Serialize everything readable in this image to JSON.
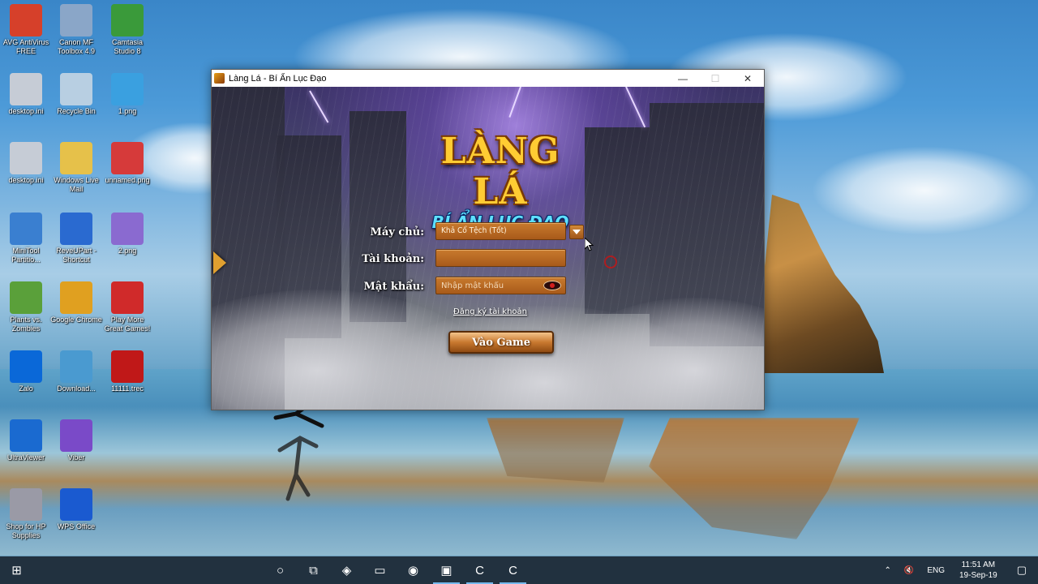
{
  "desktop": {
    "icons": [
      {
        "label": "AVG AntiVirus FREE",
        "icon": "avg-antivirus-icon",
        "color": "#d6402a"
      },
      {
        "label": "Canon MF Toolbox 4.9",
        "icon": "canon-toolbox-icon",
        "color": "#8aa6c8"
      },
      {
        "label": "Camtasia Studio 8",
        "icon": "camtasia-icon",
        "color": "#3a9a3a"
      },
      {
        "label": "desktop.ini",
        "icon": "ini-file-icon",
        "color": "#c6ccd6"
      },
      {
        "label": "Recycle Bin",
        "icon": "recycle-bin-icon",
        "color": "#b8cfe2"
      },
      {
        "label": "1.png",
        "icon": "image-file-icon",
        "color": "#3aa0e0"
      },
      {
        "label": "desktop.ini",
        "icon": "ini-file-icon",
        "color": "#c6ccd6"
      },
      {
        "label": "Windows Live Mail",
        "icon": "windows-live-mail-icon",
        "color": "#e6c14a"
      },
      {
        "label": "unnamed.png",
        "icon": "image-file-icon",
        "color": "#d63a3a"
      },
      {
        "label": "MiniTool Partitio...",
        "icon": "minitool-icon",
        "color": "#3a7fd0"
      },
      {
        "label": "ReveUPart - Shortcut",
        "icon": "shortcut-icon",
        "color": "#2a6ad0"
      },
      {
        "label": "2.png",
        "icon": "image-file-icon",
        "color": "#8a6ad0"
      },
      {
        "label": "Plants vs. Zombies",
        "icon": "plants-vs-zombies-icon",
        "color": "#5aa03a"
      },
      {
        "label": "Google Chrome",
        "icon": "chrome-icon",
        "color": "#e0a020"
      },
      {
        "label": "Play More Great Games!",
        "icon": "popcap-icon",
        "color": "#d02a2a"
      },
      {
        "label": "Zalo",
        "icon": "zalo-icon",
        "color": "#0a68d8"
      },
      {
        "label": "Download...",
        "icon": "download-folder-icon",
        "color": "#4a9ad0"
      },
      {
        "label": "11111.trec",
        "icon": "trec-file-icon",
        "color": "#c01818"
      },
      {
        "label": "UltraViewer",
        "icon": "ultraviewer-icon",
        "color": "#1a6ad0"
      },
      {
        "label": "Viber",
        "icon": "viber-icon",
        "color": "#7a4ac8"
      },
      {
        "label": "Shop for HP Supplies",
        "icon": "hp-printer-icon",
        "color": "#9a9aa6"
      },
      {
        "label": "WPS Office",
        "icon": "wps-office-icon",
        "color": "#1a5ad0"
      }
    ]
  },
  "window": {
    "title": "Làng Lá - Bí Ẩn Lục Đạo",
    "minimize": "—",
    "maximize": "☐",
    "close": "✕"
  },
  "game": {
    "logo_line1": "LÀNG LÁ",
    "logo_line2": "BÍ ẨN LỤC ĐẠO",
    "server_label": "Máy chủ:",
    "server_value": "Khả Cổ Tệch (Tốt)",
    "account_label": "Tài khoản:",
    "account_value": "",
    "password_label": "Mật khẩu:",
    "password_placeholder": "Nhập mật khẩu",
    "register_link": "Đăng ký tài khoản",
    "play_button": "Vào Game"
  },
  "taskbar": {
    "start": "⊞",
    "search": "○",
    "task_view": "⧉",
    "apps": [
      {
        "name": "taskbar-app-1",
        "glyph": "◈",
        "active": false
      },
      {
        "name": "file-explorer",
        "glyph": "▭",
        "active": false
      },
      {
        "name": "google-chrome",
        "glyph": "◉",
        "active": false
      },
      {
        "name": "lang-la-game",
        "glyph": "▣",
        "active": true
      },
      {
        "name": "camtasia",
        "glyph": "C",
        "active": true
      },
      {
        "name": "camtasia-recorder",
        "glyph": "C",
        "active": true
      }
    ],
    "tray_chevron": "⌃",
    "volume": "🔇",
    "language": "ENG",
    "time": "11:51 AM",
    "date": "19-Sep-19",
    "notifications": "▢"
  }
}
